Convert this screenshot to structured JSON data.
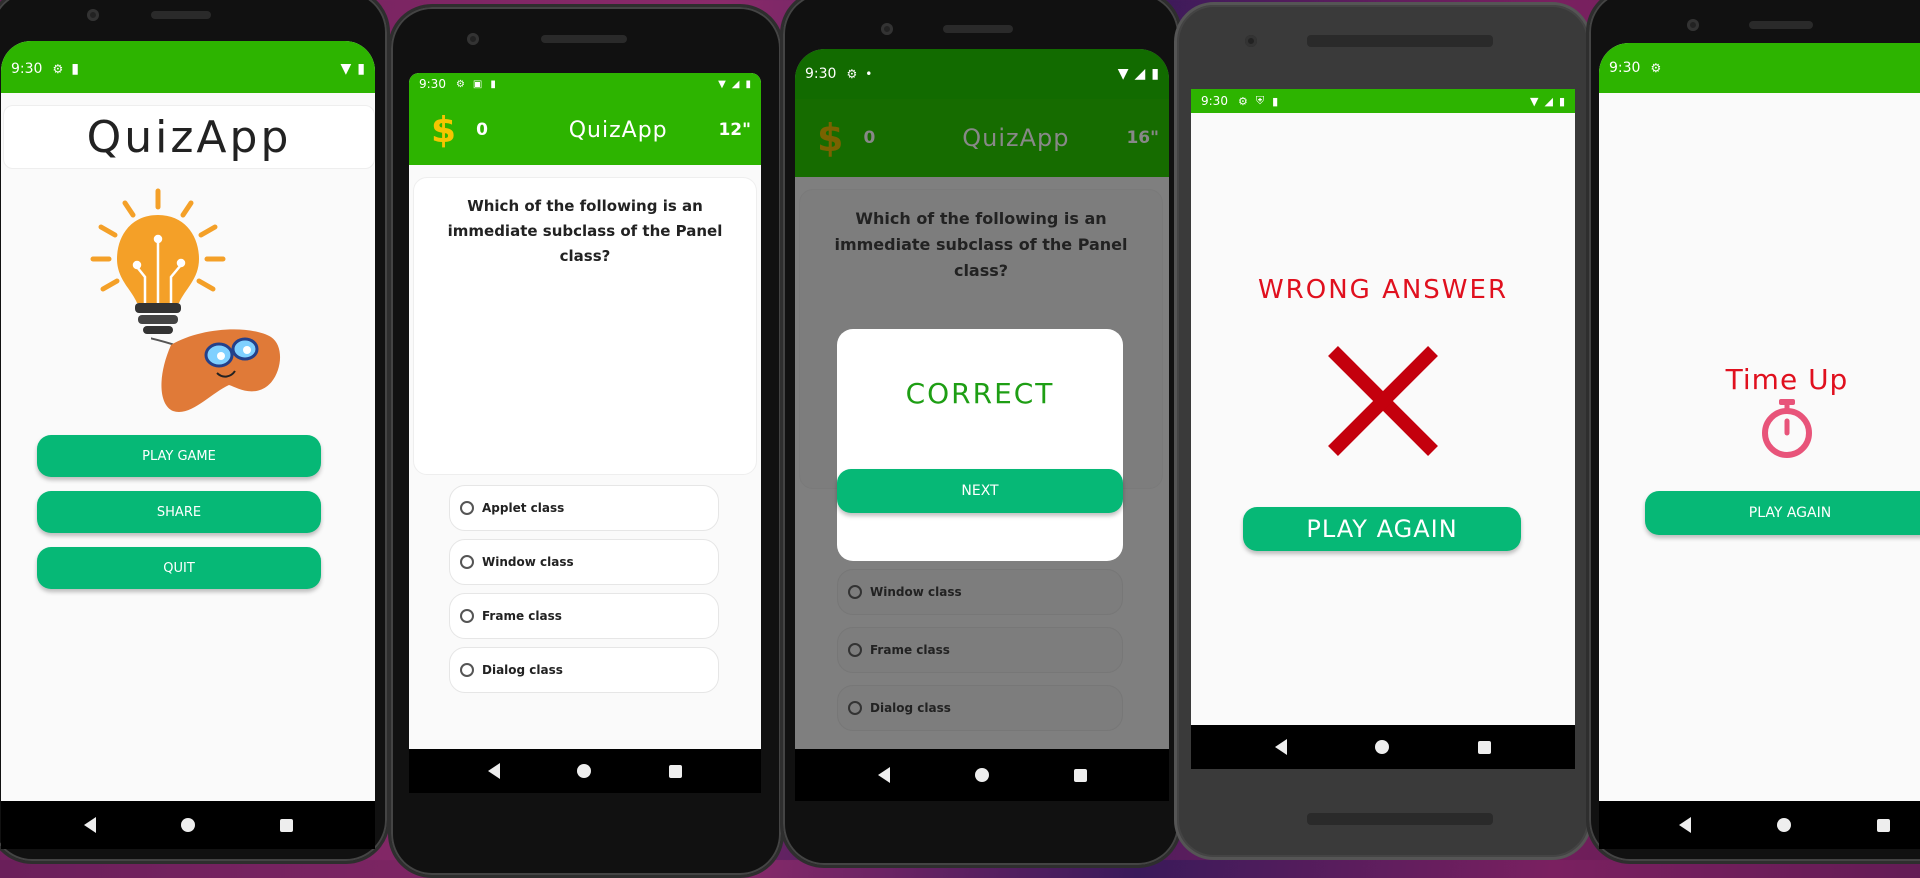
{
  "colors": {
    "green": "#2db400",
    "button": "#06b876",
    "red": "#e0101e",
    "x_red": "#c4000d",
    "pink": "#e8547a",
    "dollar": "#f5c500"
  },
  "status": {
    "time": "9:30"
  },
  "screen1": {
    "title": "QuizApp",
    "buttons": [
      "PLAY GAME",
      "SHARE",
      "QUIT"
    ],
    "icons": [
      "lightbulb-circuit-icon",
      "game-controller-icon"
    ]
  },
  "screen2": {
    "score": "0",
    "title": "QuizApp",
    "timer": "12\"",
    "question": "Which of the following is an immediate subclass of the Panel class?",
    "options": [
      "Applet class",
      "Window class",
      "Frame class",
      "Dialog class"
    ]
  },
  "screen3": {
    "score": "0",
    "title": "QuizApp",
    "timer": "16\"",
    "question": "Which of the following is an immediate subclass of the Panel class?",
    "options": [
      "Window class",
      "Frame class",
      "Dialog class"
    ],
    "dialog": {
      "title": "CORRECT",
      "button": "NEXT"
    }
  },
  "screen4": {
    "title": "WRONG ANSWER",
    "button": "PLAY AGAIN"
  },
  "screen5": {
    "title": "Time Up",
    "button": "PLAY AGAIN"
  }
}
